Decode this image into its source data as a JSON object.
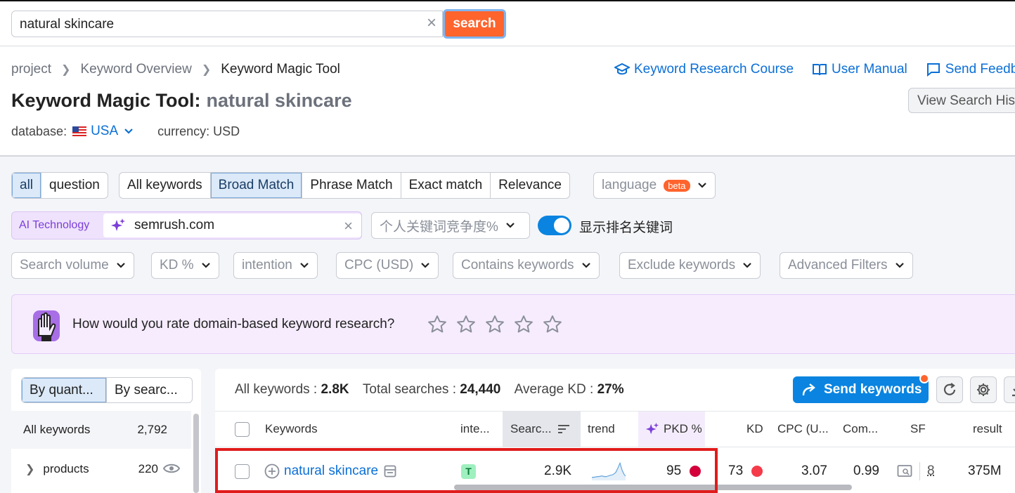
{
  "search": {
    "value": "natural skincare",
    "clear_symbol": "×",
    "button_label": "search"
  },
  "breadcrumb": [
    "project",
    "Keyword Overview",
    "Keyword Magic Tool"
  ],
  "help_links": [
    "Keyword Research Course",
    "User Manual",
    "Send Feedback"
  ],
  "page_title": {
    "prefix": "Keyword Magic Tool:",
    "keyword": "natural skincare"
  },
  "history_button": "View Search History",
  "database": {
    "label": "database:",
    "value": "USA",
    "currency_label": "currency: USD"
  },
  "match_tabs": {
    "type_tabs": [
      "all",
      "question"
    ],
    "match_tabs": [
      "All keywords",
      "Broad Match",
      "Phrase Match",
      "Exact match",
      "Relevance"
    ],
    "active_type": "all",
    "active_match": "Broad Match"
  },
  "language": {
    "label": "language",
    "badge": "beta"
  },
  "ai": {
    "label": "AI Technology",
    "domain": "semrush.com",
    "pkd_placeholder": "个人关键词竞争度%",
    "toggle_label": "显示排名关键词",
    "toggle_on": true
  },
  "filters": [
    "Search volume",
    "KD %",
    "intention",
    "CPC (USD)",
    "Contains keywords",
    "Exclude keywords",
    "Advanced Filters"
  ],
  "rating": {
    "question": "How would you rate domain-based keyword research?",
    "stars": 5
  },
  "left_panel": {
    "tabs": [
      "By quant...",
      "By searc..."
    ],
    "all_label": "All keywords",
    "all_count": "2,792",
    "groups": [
      {
        "label": "products",
        "count": "220"
      }
    ]
  },
  "summary": {
    "all_label": "All keywords :",
    "all_value": "2.8K",
    "total_label": "Total searches :",
    "total_value": "24,440",
    "kd_label": "Average KD :",
    "kd_value": "27%"
  },
  "send_button": "Send keywords",
  "columns": [
    "Keywords",
    "inte...",
    "Searc...",
    "trend",
    "PKD %",
    "KD",
    "CPC (U...",
    "Com...",
    "SF",
    "result"
  ],
  "rows": [
    {
      "keyword": "natural skincare",
      "intent": "T",
      "volume": "2.9K",
      "pkd": "95",
      "kd": "73",
      "cpc": "3.07",
      "com": "0.99",
      "sf": "8",
      "results": "375M"
    }
  ],
  "colors": {
    "accent": "#0a84e0",
    "brand_orange": "#ff642d",
    "kd_hard": "#d4003a",
    "kd_high": "#f53a4a",
    "highlight": "#e01c1c"
  }
}
